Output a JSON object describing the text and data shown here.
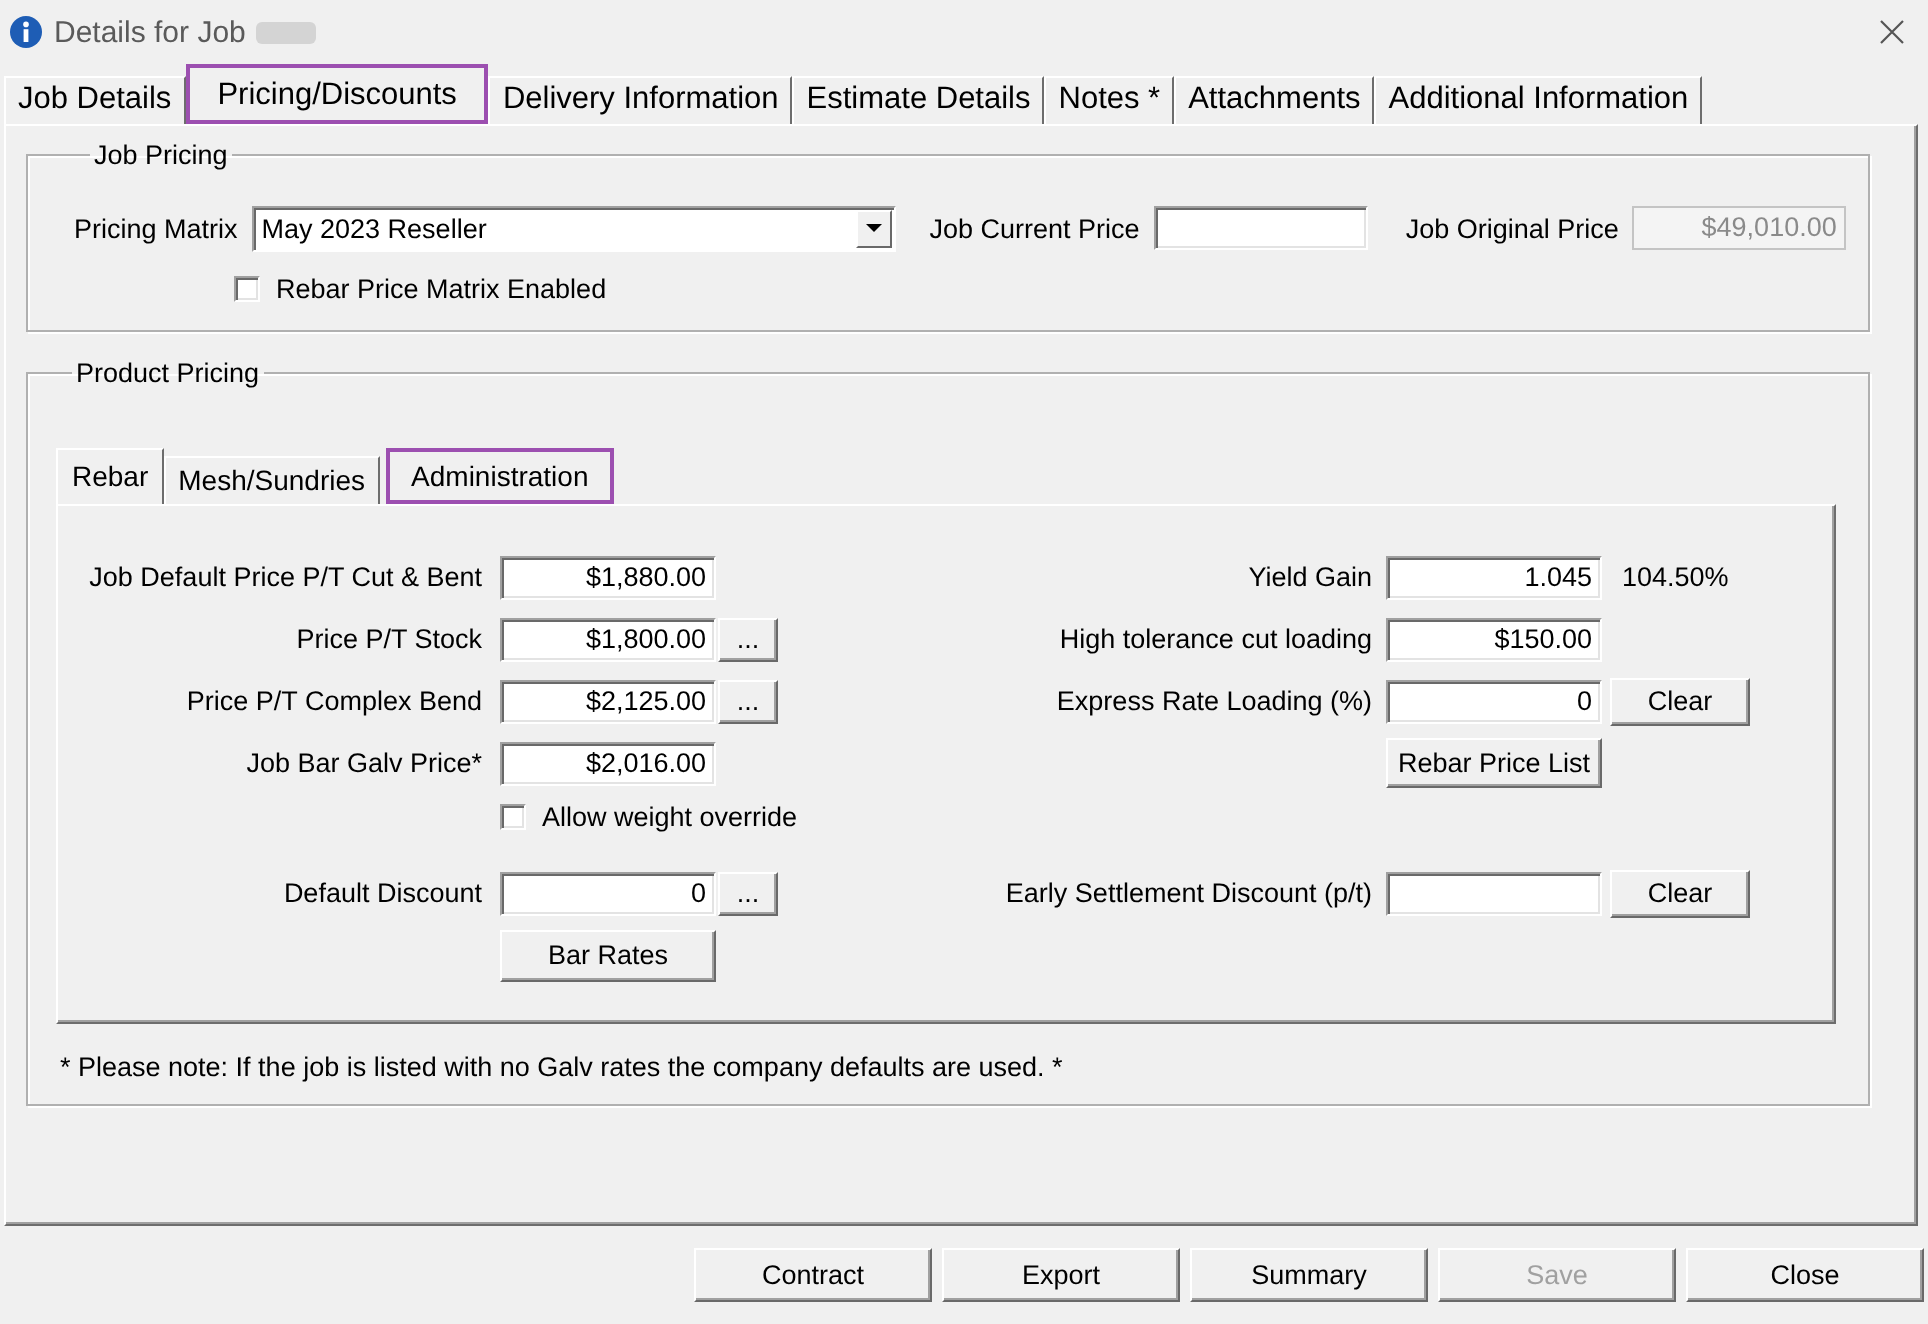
{
  "window": {
    "title": "Details for Job"
  },
  "tabs": [
    {
      "label": "Job Details",
      "selected": false,
      "highlighted": false
    },
    {
      "label": "Pricing/Discounts",
      "selected": true,
      "highlighted": true
    },
    {
      "label": "Delivery Information",
      "selected": false,
      "highlighted": false
    },
    {
      "label": "Estimate Details",
      "selected": false,
      "highlighted": false
    },
    {
      "label": "Notes *",
      "selected": false,
      "highlighted": false
    },
    {
      "label": "Attachments",
      "selected": false,
      "highlighted": false
    },
    {
      "label": "Additional Information",
      "selected": false,
      "highlighted": false
    }
  ],
  "job_pricing": {
    "title": "Job Pricing",
    "fields": [
      {
        "kind": "dropdown",
        "label": "Pricing Matrix",
        "value": "May 2023 Reseller",
        "disabled": false
      },
      {
        "kind": "text",
        "label": "Job Current Price",
        "disabled": false
      },
      {
        "kind": "text",
        "label": "Job Original Price",
        "value": "$49,010.00",
        "disabled": true
      }
    ],
    "checkbox": {
      "label": "Rebar Price Matrix Enabled",
      "checked": false
    }
  },
  "product_pricing": {
    "title": "Product Pricing",
    "tabs": [
      {
        "label": "Rebar",
        "selected": true,
        "highlighted": false
      },
      {
        "label": "Mesh/Sundries",
        "selected": false,
        "highlighted": false
      },
      {
        "label": "Administration",
        "selected": false,
        "highlighted": true
      }
    ],
    "rebar_panel": {
      "columns": [
        {
          "upper": [
            {
              "kind": "field",
              "label": "Job Default Price P/T Cut & Bent",
              "value": "$1,880.00"
            },
            {
              "kind": "field",
              "label": "Price P/T Stock",
              "value": "$1,800.00",
              "button": "..."
            },
            {
              "kind": "field",
              "label": "Price P/T Complex Bend",
              "value": "$2,125.00",
              "button": "..."
            },
            {
              "kind": "field",
              "label": "Job Bar Galv Price*",
              "value": "$2,016.00"
            },
            {
              "kind": "checkbox",
              "label": "Allow weight override",
              "checked": false
            }
          ],
          "lower": [
            {
              "kind": "field",
              "label": "Default Discount",
              "value": "0",
              "button": "..."
            },
            {
              "kind": "button",
              "label": "Bar Rates"
            }
          ]
        },
        {
          "upper": [
            {
              "kind": "field",
              "label": "Yield Gain",
              "value": "1.045",
              "reading": "104.50%"
            },
            {
              "kind": "field",
              "label": "High tolerance cut loading",
              "value": "$150.00"
            },
            {
              "kind": "field",
              "label": "Express Rate Loading (%)",
              "value": "0",
              "button": "Clear"
            },
            {
              "kind": "button",
              "label": "Rebar Price List"
            }
          ],
          "lower": [
            {
              "kind": "field",
              "label": "Early Settlement Discount (p/t)",
              "button": "Clear"
            }
          ]
        }
      ]
    },
    "note": "* Please note: If the job is listed with no Galv rates the company defaults are used. *"
  },
  "buttons": [
    {
      "label": "Contract",
      "disabled": false
    },
    {
      "label": "Export",
      "disabled": false
    },
    {
      "label": "Summary",
      "disabled": false
    },
    {
      "label": "Save",
      "disabled": true
    },
    {
      "label": "Close",
      "disabled": false
    }
  ]
}
